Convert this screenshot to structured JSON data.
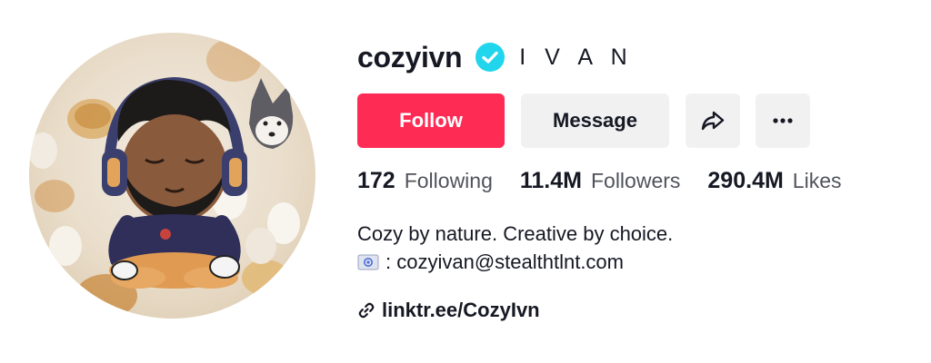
{
  "profile": {
    "username": "cozyivn",
    "nickname": "I V A N",
    "verified": true
  },
  "buttons": {
    "follow_label": "Follow",
    "message_label": "Message",
    "share_icon": "share-arrow-icon",
    "more_icon": "more-dots-icon"
  },
  "stats": {
    "following_count": "172",
    "following_label": "Following",
    "followers_count": "11.4M",
    "followers_label": "Followers",
    "likes_count": "290.4M",
    "likes_label": "Likes"
  },
  "bio": {
    "line1": "Cozy by nature. Creative by choice.",
    "line2_icon": "email-emoji",
    "line2_text": ": cozyivan@stealthtlnt.com"
  },
  "link": {
    "icon": "link-icon",
    "text": "linktr.ee/CozyIvn"
  },
  "colors": {
    "follow_bg": "#fe2c55",
    "secondary_bg": "#f1f1f2",
    "verified": "#20d5ec",
    "text": "#161823"
  }
}
